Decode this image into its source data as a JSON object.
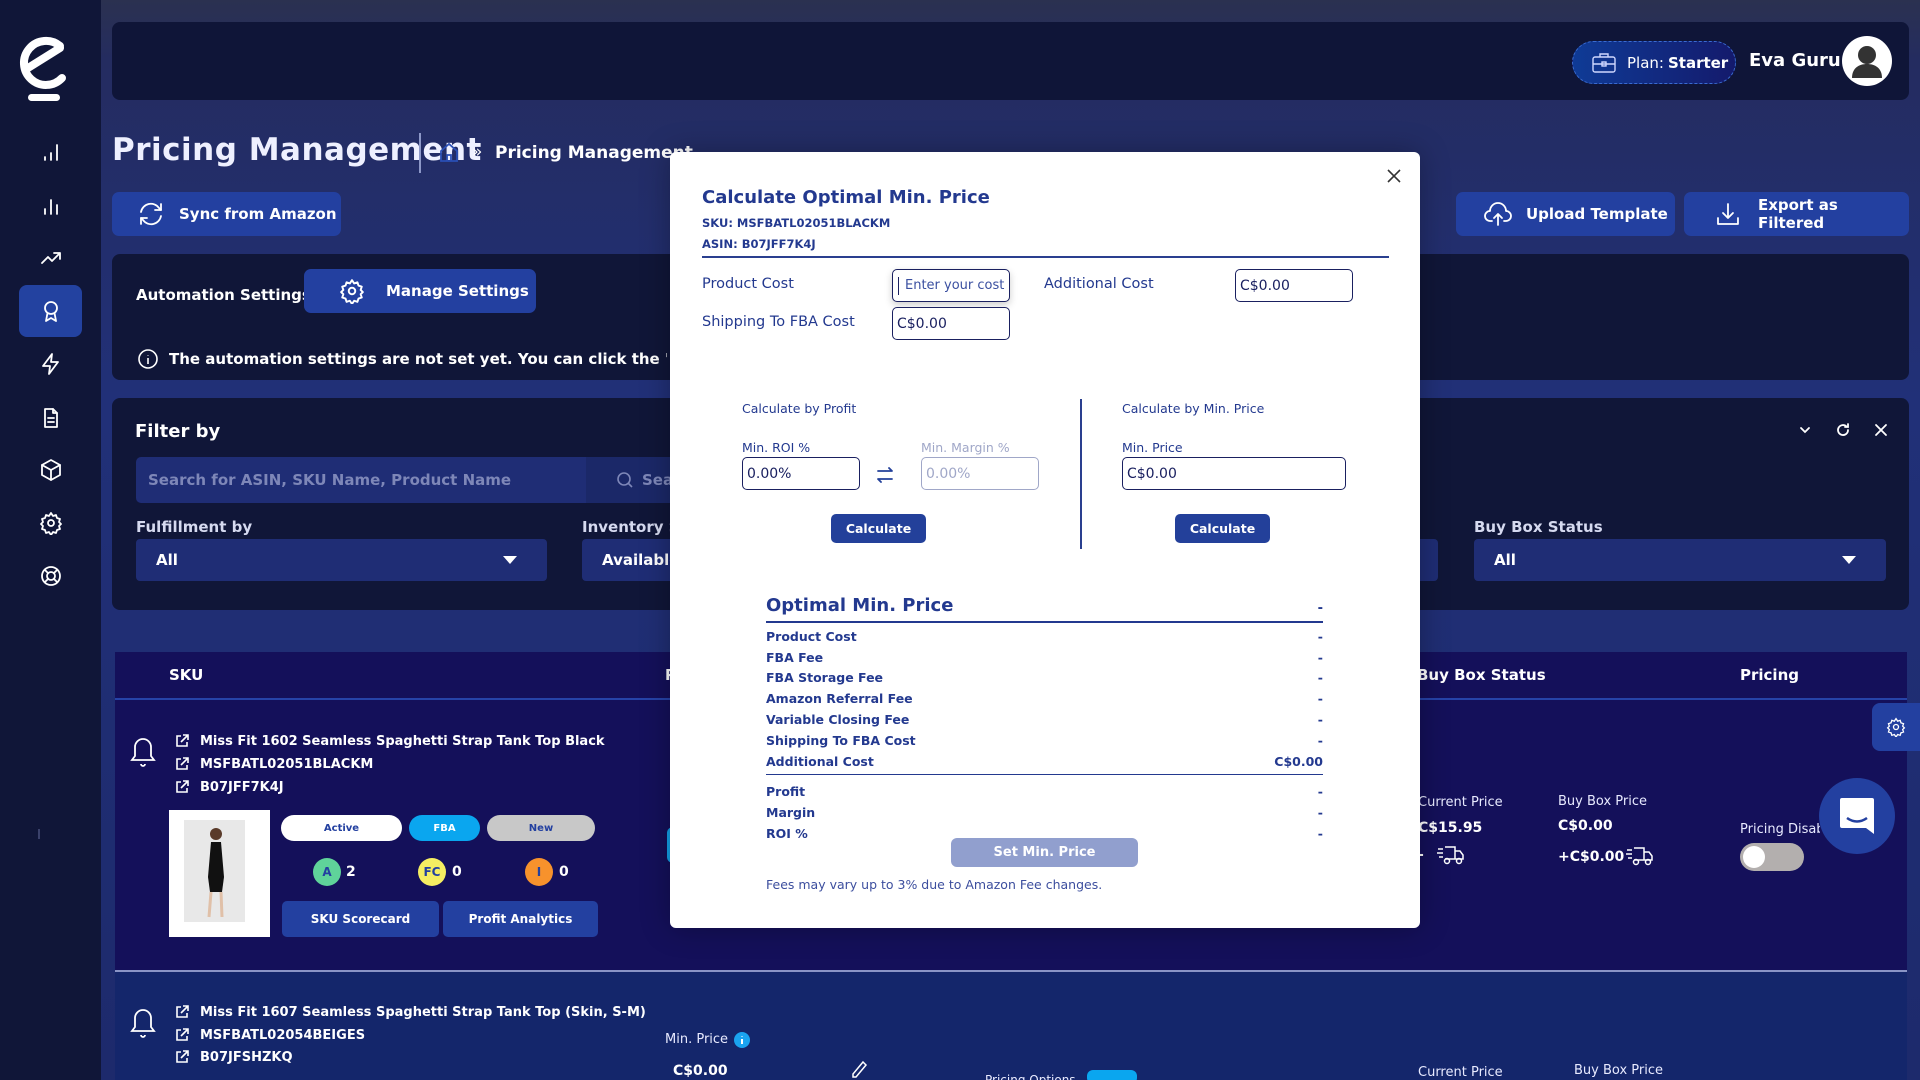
{
  "app": {
    "brand_logo": "eva-logo"
  },
  "sidebar": {
    "items": [
      {
        "icon": "signal-bars-icon",
        "active": false
      },
      {
        "icon": "bar-chart-icon",
        "active": false
      },
      {
        "icon": "trending-up-icon",
        "active": false
      },
      {
        "icon": "award-ribbon-icon",
        "active": true
      },
      {
        "icon": "lightning-icon",
        "active": false
      },
      {
        "icon": "document-icon",
        "active": false
      },
      {
        "icon": "package-icon",
        "active": false
      },
      {
        "icon": "settings-icon",
        "active": false
      },
      {
        "icon": "lifebuoy-icon",
        "active": false
      }
    ]
  },
  "topbar": {
    "plan_prefix": "Plan:",
    "plan_name": "Starter",
    "user_name": "Eva Guru"
  },
  "header": {
    "title": "Pricing Management",
    "breadcrumb_sep": "»",
    "breadcrumb_current": "Pricing Management"
  },
  "toolbar": {
    "sync_label": "Sync from Amazon",
    "upload_label": "Upload Template",
    "export_label": "Export as Filtered"
  },
  "automation": {
    "label": "Automation Settings",
    "manage_label": "Manage Settings",
    "info": "The automation settings are not set yet. You can click the \"Manage Settings\" button"
  },
  "filter": {
    "title": "Filter by",
    "search_placeholder": "Search for ASIN, SKU Name, Product Name",
    "search_button": "Search",
    "fulfillment_label": "Fulfillment by",
    "fulfillment_value": "All",
    "inventory_label": "Inventory Status",
    "inventory_value": "Available",
    "buybox_label": "Buy Box Status",
    "buybox_value": "All"
  },
  "table": {
    "columns": [
      "SKU",
      "Price",
      "Buy Box Status",
      "Pricing"
    ],
    "rows": [
      {
        "name": "Miss Fit 1602 Seamless Spaghetti Strap Tank Top Black",
        "sku": "MSFBATL02051BLACKM",
        "asin": "B07JFF7K4J",
        "status": "Active",
        "fulfillment": "FBA",
        "condition": "New",
        "badges": [
          {
            "label": "A",
            "count": "2",
            "color": "#5fd39a"
          },
          {
            "label": "FC",
            "count": "0",
            "color": "#f5ee62"
          },
          {
            "label": "I",
            "count": "0",
            "color": "#f7922c"
          }
        ],
        "scorecard_label": "SKU Scorecard",
        "analytics_label": "Profit Analytics",
        "current_price_label": "Current Price",
        "current_price": "C$15.95",
        "current_shipping": "-",
        "buybox_price_label": "Buy Box Price",
        "buybox_price": "C$0.00",
        "buybox_shipping": "+C$0.00",
        "pricing_label": "Pricing Disabled",
        "pricing_enabled": false
      },
      {
        "name": "Miss Fit 1607 Seamless Spaghetti Strap Tank Top (Skin, S-M)",
        "sku": "MSFBATL02054BEIGES",
        "asin": "B07JFSHZKQ",
        "min_price_label": "Min. Price",
        "min_price": "C$0.00",
        "pricing_options_label": "Pricing Options",
        "current_price_label": "Current Price",
        "buybox_price_label": "Buy Box Price"
      }
    ]
  },
  "modal": {
    "title": "Calculate Optimal Min. Price",
    "sku_line": "SKU: MSFBATL02051BLACKM",
    "asin_line": "ASIN: B07JFF7K4J",
    "product_cost_label": "Product Cost",
    "product_cost_placeholder": "Enter your cost",
    "additional_cost_label": "Additional Cost",
    "additional_cost_value": "C$0.00",
    "shipping_label": "Shipping To FBA Cost",
    "shipping_value": "C$0.00",
    "by_profit_title": "Calculate by Profit",
    "min_roi_label": "Min. ROI %",
    "min_roi_value": "0.00%",
    "min_margin_label": "Min. Margin %",
    "min_margin_value": "0.00%",
    "by_price_title": "Calculate by Min. Price",
    "min_price_label": "Min. Price",
    "min_price_value": "C$0.00",
    "calculate_label": "Calculate",
    "summary_title": "Optimal Min. Price",
    "summary_value": "-",
    "cost_rows": [
      {
        "label": "Product Cost",
        "value": "-"
      },
      {
        "label": "FBA Fee",
        "value": "-"
      },
      {
        "label": "FBA Storage Fee",
        "value": "-"
      },
      {
        "label": "Amazon Referral Fee",
        "value": "-"
      },
      {
        "label": "Variable Closing Fee",
        "value": "-"
      },
      {
        "label": "Shipping To FBA Cost",
        "value": "-"
      },
      {
        "label": "Additional Cost",
        "value": "C$0.00"
      }
    ],
    "result_rows": [
      {
        "label": "Profit",
        "value": "-"
      },
      {
        "label": "Margin",
        "value": "-"
      },
      {
        "label": "ROI %",
        "value": "-"
      }
    ],
    "set_button": "Set Min. Price",
    "note": "Fees may vary up to 3% due to Amazon Fee changes."
  },
  "colors": {
    "accent": "#2340a0",
    "sidebar_bg": "#101638",
    "modal_text": "#23398f",
    "fba_pill": "#0aa6ef"
  }
}
